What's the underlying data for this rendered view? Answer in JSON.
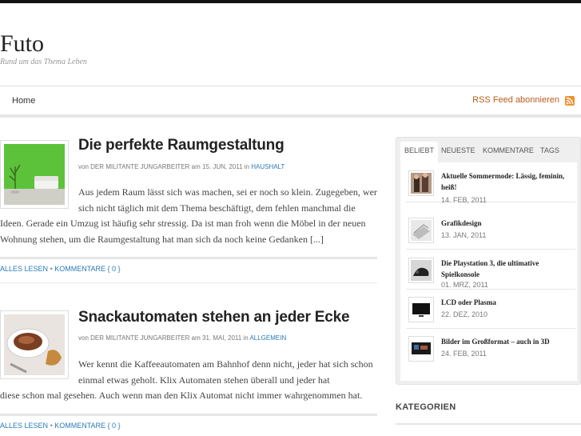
{
  "site": {
    "title": "Futo",
    "tagline": "Rund um das Thema Leben"
  },
  "nav": {
    "home": "Home",
    "rss": "RSS Feed abonnieren"
  },
  "posts": [
    {
      "title": "Die perfekte Raumgestaltung",
      "meta_by": "von DER MILITANTE JUNGARBEITER am 15. JUN, 2011 in",
      "category": "HAUSHALT",
      "excerpt_first": "Aus jedem Raum lässt sich was machen, sei er noch so klein. Zugegeben, wer sich nicht täglich mit dem Thema beschäftigt, dem fehlen manchmal die",
      "excerpt_rest": "Ideen. Gerade ein Umzug ist häufig sehr stressig. Da ist man froh wenn die Möbel in der neuen Wohnung stehen, um die Raumgestaltung hat man sich da noch keine Gedanken [...]",
      "read_more": "ALLES LESEN",
      "comments": "KOMMENTARE { 0 }"
    },
    {
      "title": "Snackautomaten stehen an jeder Ecke",
      "meta_by": "von DER MILITANTE JUNGARBEITER am 31. MAI, 2011 in",
      "category": "ALLGEMEIN",
      "excerpt_first": "Wer kennt die Kaffeeautomaten am Bahnhof denn nicht, jeder hat sich schon einmal etwas geholt. Klix Automaten stehen überall und jeder hat",
      "excerpt_rest": "diese schon mal gesehen. Auch wenn man den Klix Automat nicht immer wahrgenommen hat.",
      "read_more": "ALLES LESEN",
      "comments": "KOMMENTARE { 0 }"
    }
  ],
  "sidebar": {
    "tabs": [
      "BELIEBT",
      "NEUESTE",
      "KOMMENTARE",
      "TAGS"
    ],
    "items": [
      {
        "title": "Aktuelle Sommermode: Lässig, feminin, heiß!",
        "date": "14. FEB, 2011"
      },
      {
        "title": "Grafikdesign",
        "date": "13. JAN, 2011"
      },
      {
        "title": "Die Playstation 3, die ultimative Spielkonsole",
        "date": "01. MRZ, 2011"
      },
      {
        "title": "LCD oder Plasma",
        "date": "22. DEZ, 2010"
      },
      {
        "title": "Bilder im Großformat – auch in 3D",
        "date": "24. FEB, 2011"
      }
    ],
    "categories_title": "KATEGORIEN"
  },
  "colors": {
    "link": "#2a7ab8",
    "rss": "#b85c1c",
    "rss_icon": "#f29130",
    "thumb_green": "#5cc23a"
  }
}
